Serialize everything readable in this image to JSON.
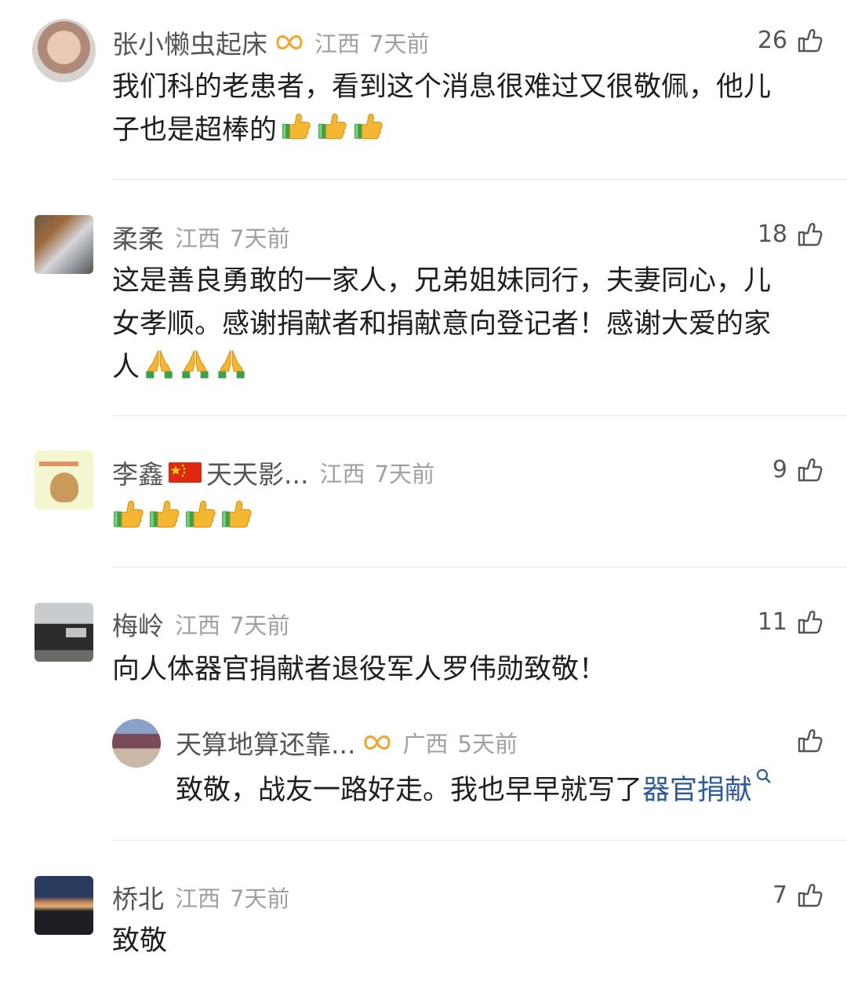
{
  "comments": [
    {
      "username": "张小懒虫起床",
      "location": "江西",
      "time": "7天前",
      "likes": "26",
      "text_lines": [
        "我们科的老患者，看到这个消息很难过又很敬佩，他儿",
        "子也是超棒的"
      ],
      "emoji": "thumbs-up",
      "emoji_count": 3,
      "has_vip_badge": true
    },
    {
      "username": "柔柔",
      "location": "江西",
      "time": "7天前",
      "likes": "18",
      "text_lines": [
        "这是善良勇敢的一家人，兄弟姐妹同行，夫妻同心，儿",
        "女孝顺。感谢捐献者和捐献意向登记者！感谢大爱的家",
        "人"
      ],
      "emoji": "folded-hands",
      "emoji_count": 3
    },
    {
      "username": "李鑫",
      "username_suffix": "天天影...",
      "username_flag": "china-flag",
      "location": "江西",
      "time": "7天前",
      "likes": "9",
      "emoji": "thumbs-up",
      "emoji_count": 4
    },
    {
      "username": "梅岭",
      "location": "江西",
      "time": "7天前",
      "likes": "11",
      "text_lines": [
        "向人体器官捐献者退役军人罗伟勋致敬！"
      ]
    },
    {
      "username": "桥北",
      "location": "江西",
      "time": "7天前",
      "likes": "7",
      "text_lines": [
        "致敬"
      ]
    }
  ],
  "reply": {
    "username": "天算地算还靠...",
    "location": "广西",
    "time": "5天前",
    "text": "致敬，战友一路好走。我也早早就写了",
    "link_text": "器官捐献",
    "link_icon": "search-icon",
    "has_vip_badge": true
  },
  "icons": {
    "like": "thumbs-up-outline-icon",
    "badge": "vip-infinity-icon"
  },
  "colors": {
    "badge": "#f2a42c",
    "link": "#2d5a9a",
    "emoji": "#f5b731",
    "emoji_cuff": "#3aa34a"
  }
}
